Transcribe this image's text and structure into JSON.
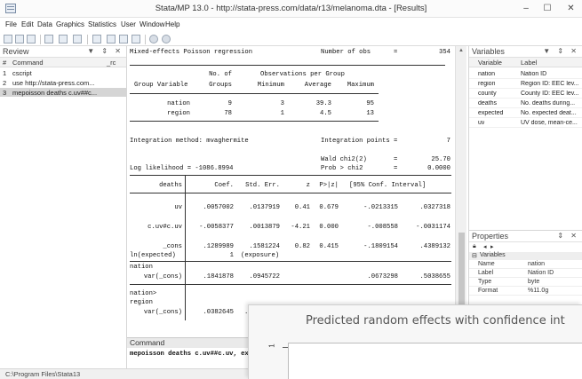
{
  "window": {
    "title": "Stata/MP 13.0 - http://stata-press.com/data/r13/melanoma.dta - [Results]",
    "minimize": "–",
    "maximize": "☐",
    "close": "✕"
  },
  "menu": [
    "File",
    "Edit",
    "Data",
    "Graphics",
    "Statistics",
    "User",
    "Window",
    "Help"
  ],
  "review": {
    "title": "Review",
    "header_icons": "▼ ⇕ ✕",
    "col_num": "#",
    "col_command": "Command",
    "col_rc": "_rc",
    "rows": [
      {
        "num": "1",
        "command": "cscript",
        "rc": ""
      },
      {
        "num": "2",
        "command": "use http://stata-press.com...",
        "rc": ""
      },
      {
        "num": "3",
        "command": "mepoisson deaths c.uv##c...",
        "rc": ""
      }
    ]
  },
  "results": {
    "header_left": "Mixed-effects Poisson regression",
    "header_right_label": "Number of obs",
    "header_right_eq": "=",
    "header_right_value": "354",
    "group_table": {
      "h1_no_of": "No. of",
      "h1_obs": "Observations per Group",
      "h2_group": "Group Variable",
      "h2_groups": "Groups",
      "h2_min": "Minimum",
      "h2_avg": "Average",
      "h2_max": "Maximum",
      "rows": [
        {
          "name": "nation",
          "groups": "9",
          "min": "3",
          "avg": "39.3",
          "max": "95"
        },
        {
          "name": "region",
          "groups": "78",
          "min": "1",
          "avg": "4.5",
          "max": "13"
        }
      ]
    },
    "integration_method": "Integration method: mvaghermite",
    "integration_points_label": "Integration points =",
    "integration_points_value": "7",
    "wald_label": "Wald chi2(2)",
    "wald_eq": "=",
    "wald_value": "25.70",
    "log_likelihood": "Log likelihood = -1086.8994",
    "prob_label": "Prob > chi2",
    "prob_eq": "=",
    "prob_value": "0.0000",
    "coef_header": {
      "depvar": "deaths",
      "coef": "Coef.",
      "se": "Std. Err.",
      "z": "z",
      "p": "P>|z|",
      "ci": "[95% Conf. Interval]"
    },
    "coef_rows": [
      {
        "name": "uv",
        "coef": ".0057002",
        "se": ".0137919",
        "z": "0.41",
        "p": "0.679",
        "lo": "-.0213315",
        "hi": ".0327318"
      },
      {
        "name": "c.uv#c.uv",
        "coef": "-.0058377",
        "se": ".0013879",
        "z": "-4.21",
        "p": "0.000",
        "lo": "-.008558",
        "hi": "-.0031174"
      },
      {
        "name": "_cons",
        "coef": ".1289989",
        "se": ".1581224",
        "z": "0.82",
        "p": "0.415",
        "lo": "-.1809154",
        "hi": ".4389132"
      }
    ],
    "offset_label": "ln(expected)",
    "offset_value": "1",
    "offset_note": "(exposure)",
    "re_rows": [
      {
        "group": "nation",
        "name": "var(_cons)",
        "est": ".1841878",
        "se": ".0945722",
        "lo": ".0673298",
        "hi": ".5038655"
      },
      {
        "group": "nation>",
        "group2": "region",
        "name": "var(_cons)",
        "est": ".0382645",
        "se": "."
      }
    ]
  },
  "command": {
    "title": "Command",
    "text": "mepoisson deaths c.uv##c.uv, expo"
  },
  "variables": {
    "title": "Variables",
    "header_icons": "▼ ⇕ ✕",
    "col_variable": "Variable",
    "col_label": "Label",
    "rows": [
      {
        "name": "nation",
        "label": "Nation ID"
      },
      {
        "name": "region",
        "label": "Region ID: EEC lev..."
      },
      {
        "name": "county",
        "label": "County ID: EEC lev..."
      },
      {
        "name": "deaths",
        "label": "No. deaths during..."
      },
      {
        "name": "expected",
        "label": "No. expected deat..."
      },
      {
        "name": "uv",
        "label": "UV dose, mean-ce..."
      }
    ]
  },
  "properties": {
    "title": "Properties",
    "header_icons": "⇕ ✕",
    "section": "Variables",
    "rows": [
      {
        "key": "Name",
        "value": "nation"
      },
      {
        "key": "Label",
        "value": "Nation ID"
      },
      {
        "key": "Type",
        "value": "byte"
      },
      {
        "key": "Format",
        "value": "%11.0g"
      }
    ]
  },
  "statusbar": {
    "path": "C:\\Program Files\\Stata13"
  },
  "graph": {
    "title": "Predicted random effects with confidence int",
    "ytick": "1"
  }
}
